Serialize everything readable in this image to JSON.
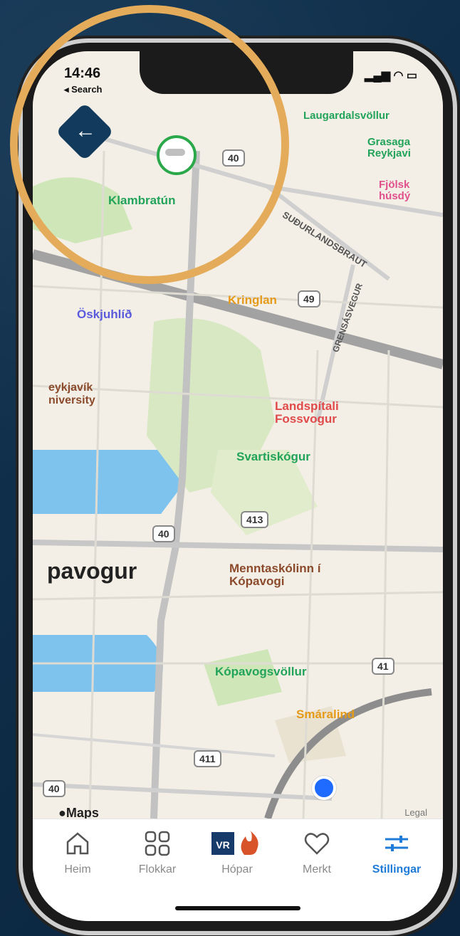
{
  "status": {
    "time": "14:46",
    "back_app": "◂ Search"
  },
  "map": {
    "labels": [
      {
        "text": "Laugardalsvöllur",
        "color": "#22a35a"
      },
      {
        "text": "Grasaga Reykjavi",
        "color": "#22a35a"
      },
      {
        "text": "Fjölsk húsdý",
        "color": "#e0508c"
      },
      {
        "text": "Klambratún",
        "color": "#22a35a"
      },
      {
        "text": "SUÐURLANDSBRAUT",
        "color": "#555"
      },
      {
        "text": "GRENSÁSVEGUR",
        "color": "#555"
      },
      {
        "text": "Kringlan",
        "color": "#e69a1a"
      },
      {
        "text": "Öskjuhlíð",
        "color": "#5a5adc"
      },
      {
        "text": "eykjavík niversity",
        "color": "#8b4a2b"
      },
      {
        "text": "Landspítali Fossvogur",
        "color": "#e14a4a"
      },
      {
        "text": "Svartiskógur",
        "color": "#22a35a"
      },
      {
        "text": "pavogur",
        "color": "#222"
      },
      {
        "text": "Menntaskólinn í Kópavogi",
        "color": "#8b4a2b"
      },
      {
        "text": "Kópavogsvöllur",
        "color": "#22a35a"
      },
      {
        "text": "Smáralind",
        "color": "#e69a1a"
      }
    ],
    "routes": [
      "40",
      "49",
      "413",
      "40",
      "41",
      "411",
      "40"
    ],
    "attribution": "Maps",
    "legal": "Legal"
  },
  "tabs": [
    {
      "label": "Heim",
      "icon": "home-icon"
    },
    {
      "label": "Flokkar",
      "icon": "grid-icon"
    },
    {
      "label": "Hópar",
      "icon": "vr-logo-icon"
    },
    {
      "label": "Merkt",
      "icon": "heart-icon"
    },
    {
      "label": "Stillingar",
      "icon": "sliders-icon"
    }
  ],
  "colors": {
    "accent": "#1e7bd8",
    "highlight_circle": "#e4ac5a",
    "back_button": "#123a5c"
  }
}
